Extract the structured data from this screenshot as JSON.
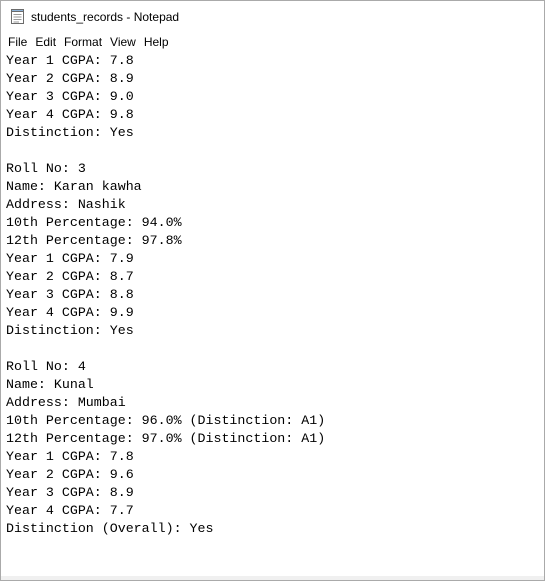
{
  "window": {
    "title": "students_records - Notepad",
    "icon": "notepad-icon"
  },
  "menu": {
    "items": [
      "File",
      "Edit",
      "Format",
      "View",
      "Help"
    ]
  },
  "editor": {
    "lines": [
      "Year 1 CGPA: 7.8",
      "Year 2 CGPA: 8.9",
      "Year 3 CGPA: 9.0",
      "Year 4 CGPA: 9.8",
      "Distinction: Yes",
      "",
      "Roll No: 3",
      "Name: Karan kawha",
      "Address: Nashik",
      "10th Percentage: 94.0%",
      "12th Percentage: 97.8%",
      "Year 1 CGPA: 7.9",
      "Year 2 CGPA: 8.7",
      "Year 3 CGPA: 8.8",
      "Year 4 CGPA: 9.9",
      "Distinction: Yes",
      "",
      "Roll No: 4",
      "Name: Kunal",
      "Address: Mumbai",
      "10th Percentage: 96.0% (Distinction: A1)",
      "12th Percentage: 97.0% (Distinction: A1)",
      "Year 1 CGPA: 7.8",
      "Year 2 CGPA: 9.6",
      "Year 3 CGPA: 8.9",
      "Year 4 CGPA: 7.7",
      "Distinction (Overall): Yes"
    ]
  }
}
